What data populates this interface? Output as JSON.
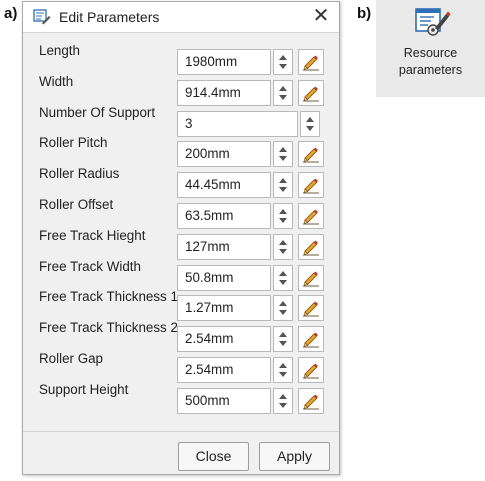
{
  "panel_labels": {
    "a": "a)",
    "b": "b)"
  },
  "dialog": {
    "title": "Edit Parameters",
    "close_glyph": "✕",
    "fields": [
      {
        "label": "Length",
        "value": "1980mm",
        "has_edit": true
      },
      {
        "label": "Width",
        "value": "914.4mm",
        "has_edit": true
      },
      {
        "label": "Number Of Support",
        "value": "3",
        "has_edit": false
      },
      {
        "label": "Roller Pitch",
        "value": "200mm",
        "has_edit": true
      },
      {
        "label": "Roller Radius",
        "value": "44.45mm",
        "has_edit": true
      },
      {
        "label": "Roller Offset",
        "value": "63.5mm",
        "has_edit": true
      },
      {
        "label": "Free Track Hieght",
        "value": "127mm",
        "has_edit": true
      },
      {
        "label": "Free Track Width",
        "value": "50.8mm",
        "has_edit": true
      },
      {
        "label": "Free Track Thickness 1",
        "value": "1.27mm",
        "has_edit": true
      },
      {
        "label": "Free Track Thickness 2",
        "value": "2.54mm",
        "has_edit": true
      },
      {
        "label": "Roller Gap",
        "value": "2.54mm",
        "has_edit": true
      },
      {
        "label": "Support Height",
        "value": "500mm",
        "has_edit": true
      }
    ],
    "buttons": {
      "close": "Close",
      "apply": "Apply"
    }
  },
  "resource_button": {
    "line1": "Resource",
    "line2": "parameters"
  },
  "colors": {
    "dialog_bg": "#f0f0f0",
    "pencil_body": "#e8a32c",
    "pencil_tip": "#c0392b",
    "icon_blue": "#2f6db5"
  }
}
